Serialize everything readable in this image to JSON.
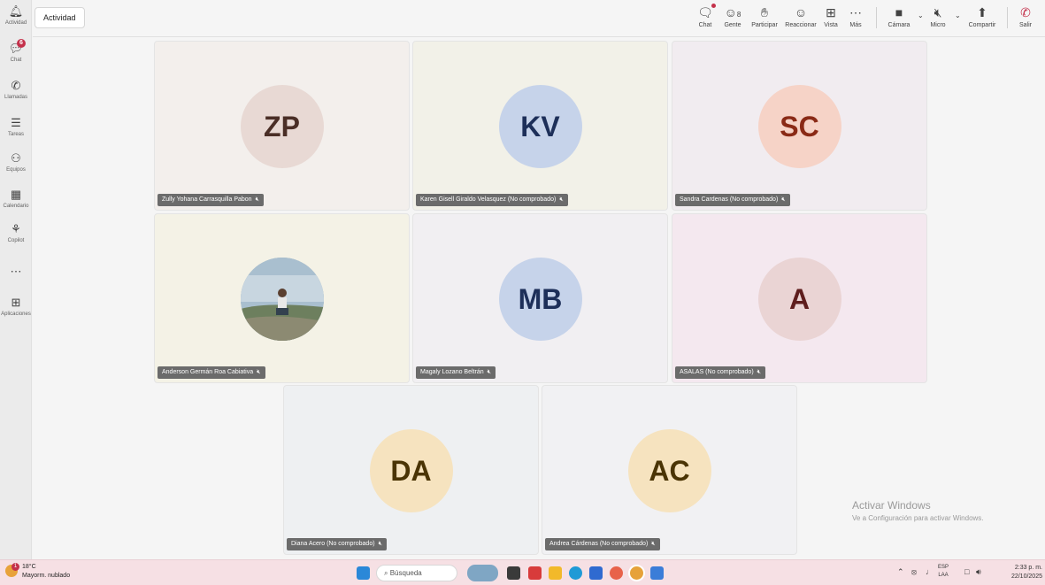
{
  "rail": {
    "items": [
      {
        "label": "Actividad",
        "icon": "bell-icon"
      },
      {
        "label": "Chat",
        "icon": "chat-icon",
        "badge": "6"
      },
      {
        "label": "Llamadas",
        "icon": "phone-icon"
      },
      {
        "label": "Tareas",
        "icon": "tasks-icon"
      },
      {
        "label": "Equipos",
        "icon": "teams-icon"
      },
      {
        "label": "Calendario",
        "icon": "calendar-icon"
      },
      {
        "label": "Copilot",
        "icon": "copilot-icon"
      },
      {
        "label": "",
        "icon": "more-icon"
      },
      {
        "label": "Aplicaciones",
        "icon": "apps-icon"
      }
    ]
  },
  "topbar": {
    "activity_tab": "Actividad",
    "buttons": {
      "chat": "Chat",
      "people": "Gente",
      "people_count": "8",
      "raise_hand": "Participar",
      "react": "Reaccionar",
      "view": "Vista",
      "more": "Más",
      "camera": "Cámara",
      "mic": "Micro",
      "share": "Compartir",
      "leave": "Salir"
    },
    "leave_color": "#c4314b"
  },
  "participants": [
    {
      "initials": "ZP",
      "name": "Zully Yohana Carrasquilla Pabon",
      "avatar_bg": "#e8d9d4",
      "text_color": "#4a2e26",
      "tile_bg": "#f3efec"
    },
    {
      "initials": "KV",
      "name": "Karen Gisell Giraldo Velasquez (No comprobado)",
      "avatar_bg": "#c6d3ea",
      "text_color": "#1d2f59",
      "tile_bg": "#f2f1e8"
    },
    {
      "initials": "SC",
      "name": "Sandra Cardenas (No comprobado)",
      "avatar_bg": "#f6d3c7",
      "text_color": "#8a2a16",
      "tile_bg": "#f1ecf0"
    },
    {
      "initials": "",
      "name": "Anderson Germán Roa Cabiativa",
      "avatar_bg": "#8fa7b8",
      "text_color": "#ffffff",
      "tile_bg": "#f4f2e6",
      "photo": true
    },
    {
      "initials": "MB",
      "name": "Magaly Lozano Beltrán",
      "avatar_bg": "#c6d3ea",
      "text_color": "#1d2f59",
      "tile_bg": "#f1eff2"
    },
    {
      "initials": "A",
      "name": "ASALAS (No comprobado)",
      "avatar_bg": "#ead4d4",
      "text_color": "#5e1d1d",
      "tile_bg": "#f4e8ef"
    },
    {
      "initials": "DA",
      "name": "Diana Acero (No comprobado)",
      "avatar_bg": "#f6e3bf",
      "text_color": "#4a3405",
      "tile_bg": "#eef0f2"
    },
    {
      "initials": "AC",
      "name": "Andrea Cárdenas (No comprobado)",
      "avatar_bg": "#f6e3bf",
      "text_color": "#4a3405",
      "tile_bg": "#f1f1f3"
    }
  ],
  "watermark": {
    "line1": "Activar Windows",
    "line2": "Ve a Configuración para activar Windows."
  },
  "taskbar": {
    "weather_temp": "18°C",
    "weather_desc": "Mayorm. nublado",
    "weather_badge": "1",
    "search_placeholder": "Búsqueda",
    "lang_line1": "ESP",
    "lang_line2": "LAA",
    "time": "2:33 p. m.",
    "date": "22/10/2025"
  }
}
